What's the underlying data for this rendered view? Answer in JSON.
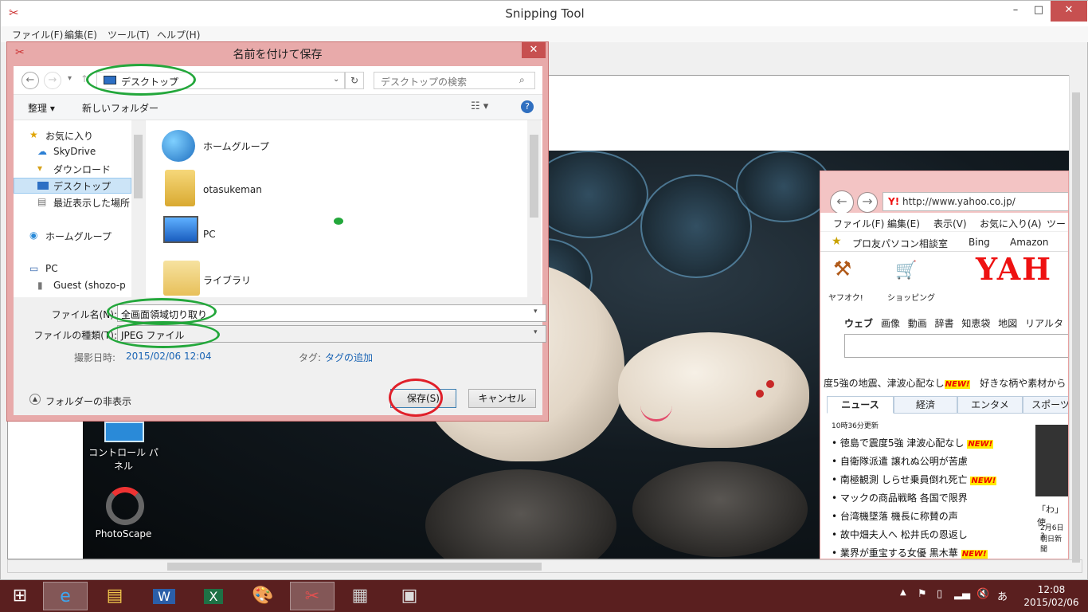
{
  "snipping_tool": {
    "title": "Snipping Tool",
    "menu": [
      "ファイル(F)",
      "編集(E)",
      "ツール(T)",
      "ヘルプ(H)"
    ],
    "window_buttons": {
      "minimize": "–",
      "maximize": "□",
      "close": "✕"
    }
  },
  "desktop": {
    "icons": [
      {
        "label": "コントロール パネル"
      },
      {
        "label": "PhotoScape"
      }
    ]
  },
  "ie": {
    "address": "http://www.yahoo.co.jp/",
    "menu": [
      "ファイル(F)",
      "編集(E)",
      "表示(V)",
      "お気に入り(A)",
      "ツール"
    ],
    "favorites": [
      "プロ友パソコン相談室",
      "Bing",
      "Amazon"
    ],
    "yahoo_logo": "YAH",
    "services": [
      "ヤフオク!",
      "ショッピング"
    ],
    "search_tabs": [
      "ウェブ",
      "画像",
      "動画",
      "辞書",
      "知恵袋",
      "地図",
      "リアルタ"
    ],
    "ticker_left": "度5強の地震、津波心配なし",
    "ticker_right": "好きな柄や素材から",
    "news_tabs": [
      "ニュース",
      "経済",
      "エンタメ",
      "スポーツ"
    ],
    "updated": "10時36分更新",
    "news": [
      {
        "text": "徳島で震度5強 津波心配なし",
        "new": true
      },
      {
        "text": "自衛隊派遣 譲れぬ公明が苦慮",
        "new": false
      },
      {
        "text": "南極観測 しらせ乗員倒れ死亡",
        "new": true
      },
      {
        "text": "マックの商品戦略 各国で限界",
        "new": false
      },
      {
        "text": "台湾機墜落 機長に称賛の声",
        "new": false
      },
      {
        "text": "故中畑夫人へ 松井氏の恩返し",
        "new": false
      },
      {
        "text": "業界が重宝する女優 黒木華",
        "new": true
      }
    ],
    "new_badge": "NEW!",
    "side_caption": "「わ」使",
    "side_date": "2月6日 3",
    "side_source": "朝日新聞"
  },
  "dialog": {
    "title": "名前を付けて保存",
    "close": "✕",
    "path": "デスクトップ",
    "search_placeholder": "デスクトップの検索",
    "organize": "整理 ▾",
    "new_folder": "新しいフォルダー",
    "nav_items": [
      "お気に入り",
      "SkyDrive",
      "ダウンロード",
      "デスクトップ",
      "最近表示した場所",
      "ホームグループ",
      "PC",
      "Guest (shozo-p"
    ],
    "files": [
      "ホームグループ",
      "otasukeman",
      "PC",
      "ライブラリ"
    ],
    "filename_label": "ファイル名(N):",
    "filename_value": "全画面領域切り取り",
    "filetype_label": "ファイルの種類(T):",
    "filetype_value": "JPEG ファイル",
    "date_label": "撮影日時:",
    "date_value": "2015/02/06 12:04",
    "tag_label": "タグ:",
    "tag_value": "タグの追加",
    "hide_folders": "フォルダーの非表示",
    "save": "保存(S)",
    "cancel": "キャンセル"
  },
  "taskbar": {
    "time": "12:08",
    "date": "2015/02/06",
    "ime": "あ"
  },
  "colors": {
    "dialog_frame": "#e8aaaa",
    "taskbar": "#5a1f1f",
    "annotation_green": "#23a73b",
    "annotation_red": "#e0202a",
    "link_blue": "#1a64b4"
  }
}
